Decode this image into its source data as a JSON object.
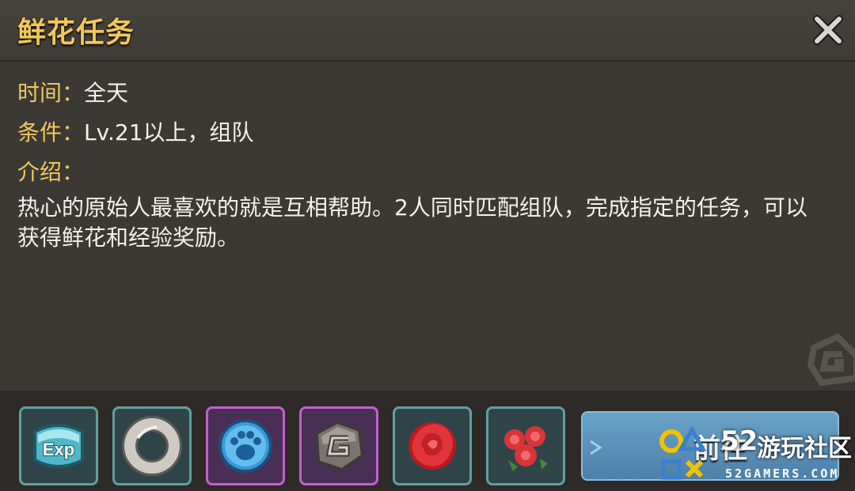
{
  "panel": {
    "title": "鲜花任务",
    "close_icon": "close-icon"
  },
  "info": {
    "time_label": "时间：",
    "time_value": "全天",
    "condition_label": "条件：",
    "condition_value": "Lv.21以上，组队",
    "intro_label": "介绍：",
    "intro_text": "热心的原始人最喜欢的就是互相帮助。2人同时匹配组队，完成指定的任务，可以获得鲜花和经验奖励。"
  },
  "rewards": [
    {
      "icon": "exp-icon",
      "text": "Exp",
      "rarity": "teal"
    },
    {
      "icon": "stone-ring-icon",
      "rarity": "teal"
    },
    {
      "icon": "blue-paw-icon",
      "rarity": "purple"
    },
    {
      "icon": "stone-g-coin-icon",
      "rarity": "purple"
    },
    {
      "icon": "rose-icon",
      "rarity": "teal"
    },
    {
      "icon": "rose-bouquet-icon",
      "rarity": "teal"
    }
  ],
  "go_button": {
    "label": "前往"
  },
  "watermark": {
    "number": "52",
    "name": "游玩社区",
    "url": "52GAMERS.COM"
  },
  "colors": {
    "background": "#3c3935",
    "label_gold": "#f2c85a",
    "slot_teal": "#5fa0a0",
    "slot_purple": "#c45fd0",
    "button_blue": "#5a90b8"
  }
}
